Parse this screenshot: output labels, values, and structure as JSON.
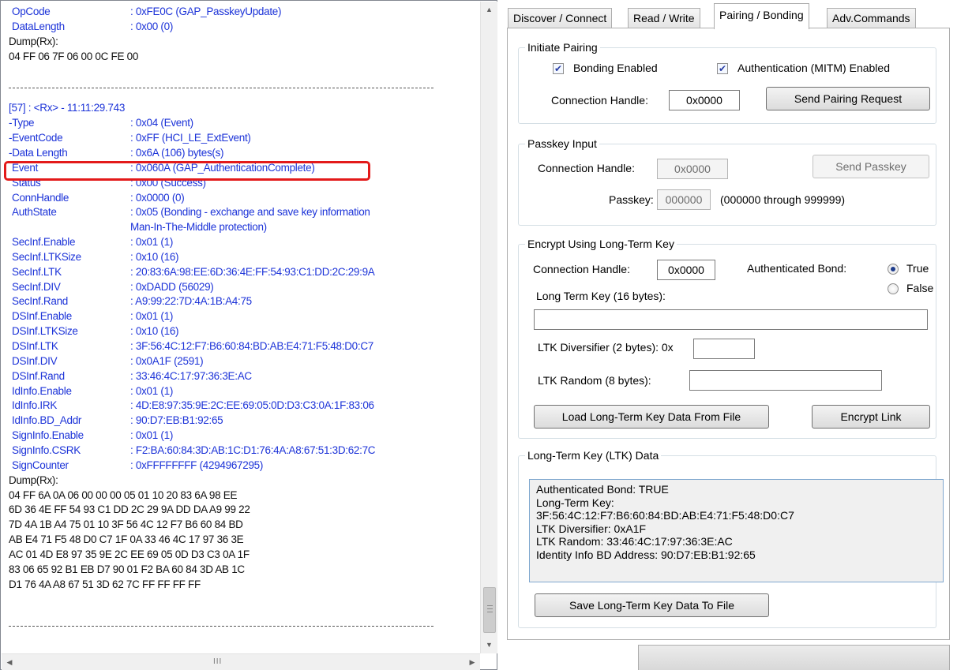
{
  "log": {
    "rows": [
      {
        "k": "OpCode",
        "v": ": 0xFE0C (GAP_PasskeyUpdate)",
        "indent": true
      },
      {
        "k": "DataLength",
        "v": ": 0x00 (0)",
        "indent": true
      },
      {
        "plain": "Dump(Rx):"
      },
      {
        "plain": "04 FF 06 7F 06 00 0C FE 00"
      },
      {
        "sep": true
      },
      {
        "k": "[57] : <Rx> - 11:11:29.743",
        "v": ""
      },
      {
        "k": "-Type",
        "v": ": 0x04 (Event)"
      },
      {
        "k": "-EventCode",
        "v": ": 0xFF (HCI_LE_ExtEvent)"
      },
      {
        "k": "-Data Length",
        "v": ": 0x6A (106) bytes(s)"
      },
      {
        "k": "Event",
        "v": ": 0x060A (GAP_AuthenticationComplete)",
        "indent": true
      },
      {
        "k": "Status",
        "v": ": 0x00 (Success)",
        "indent": true
      },
      {
        "k": "ConnHandle",
        "v": ": 0x0000 (0)",
        "indent": true
      },
      {
        "k": "AuthState",
        "v": ": 0x05 (Bonding - exchange and save key information",
        "indent": true
      },
      {
        "k": "",
        "v": "  Man-In-The-Middle protection)"
      },
      {
        "k": "SecInf.Enable",
        "v": ": 0x01 (1)",
        "indent": true
      },
      {
        "k": "SecInf.LTKSize",
        "v": ": 0x10 (16)",
        "indent": true
      },
      {
        "k": "SecInf.LTK",
        "v": ": 20:83:6A:98:EE:6D:36:4E:FF:54:93:C1:DD:2C:29:9A",
        "indent": true
      },
      {
        "k": "SecInf.DIV",
        "v": ": 0xDADD (56029)",
        "indent": true
      },
      {
        "k": "SecInf.Rand",
        "v": ": A9:99:22:7D:4A:1B:A4:75",
        "indent": true
      },
      {
        "k": "DSInf.Enable",
        "v": ": 0x01 (1)",
        "indent": true
      },
      {
        "k": "DSInf.LTKSize",
        "v": ": 0x10 (16)",
        "indent": true
      },
      {
        "k": "DSInf.LTK",
        "v": ": 3F:56:4C:12:F7:B6:60:84:BD:AB:E4:71:F5:48:D0:C7",
        "indent": true
      },
      {
        "k": "DSInf.DIV",
        "v": ": 0x0A1F (2591)",
        "indent": true
      },
      {
        "k": "DSInf.Rand",
        "v": ": 33:46:4C:17:97:36:3E:AC",
        "indent": true
      },
      {
        "k": "IdInfo.Enable",
        "v": ": 0x01 (1)",
        "indent": true
      },
      {
        "k": "IdInfo.IRK",
        "v": ": 4D:E8:97:35:9E:2C:EE:69:05:0D:D3:C3:0A:1F:83:06",
        "indent": true
      },
      {
        "k": "IdInfo.BD_Addr",
        "v": ": 90:D7:EB:B1:92:65",
        "indent": true
      },
      {
        "k": "SignInfo.Enable",
        "v": ": 0x01 (1)",
        "indent": true
      },
      {
        "k": "SignInfo.CSRK",
        "v": ": F2:BA:60:84:3D:AB:1C:D1:76:4A:A8:67:51:3D:62:7C",
        "indent": true
      },
      {
        "k": "SignCounter",
        "v": ": 0xFFFFFFFF (4294967295)",
        "indent": true
      },
      {
        "plain": "Dump(Rx):"
      },
      {
        "plain": "04 FF 6A 0A 06 00 00 00 05 01 10 20 83 6A 98 EE"
      },
      {
        "plain": "6D 36 4E FF 54 93 C1 DD 2C 29 9A DD DA A9 99 22"
      },
      {
        "plain": "7D 4A 1B A4 75 01 10 3F 56 4C 12 F7 B6 60 84 BD"
      },
      {
        "plain": "AB E4 71 F5 48 D0 C7 1F 0A 33 46 4C 17 97 36 3E"
      },
      {
        "plain": "AC 01 4D E8 97 35 9E 2C EE 69 05 0D D3 C3 0A 1F"
      },
      {
        "plain": "83 06 65 92 B1 EB D7 90 01 F2 BA 60 84 3D AB 1C"
      },
      {
        "plain": "D1 76 4A A8 67 51 3D 62 7C FF FF FF FF"
      }
    ],
    "highlight_color": "#e31a1a",
    "text_color": "#1c33d8",
    "hscroll_grip": "III"
  },
  "tabs": {
    "discover": "Discover / Connect",
    "readwrite": "Read / Write",
    "pairing": "Pairing / Bonding",
    "adv": "Adv.Commands",
    "active": "Pairing / Bonding"
  },
  "initiate": {
    "legend": "Initiate Pairing",
    "bonding_label": "Bonding Enabled",
    "bonding_checked": true,
    "auth_label": "Authentication (MITM) Enabled",
    "auth_checked": true,
    "conn_label": "Connection Handle:",
    "conn_value": "0x0000",
    "send_button": "Send Pairing Request"
  },
  "passkey": {
    "legend": "Passkey Input",
    "conn_label": "Connection Handle:",
    "conn_value": "0x0000",
    "send_button": "Send Passkey",
    "passkey_label": "Passkey:",
    "passkey_value": "000000",
    "range_hint": "(000000 through 999999)"
  },
  "encrypt": {
    "legend": "Encrypt Using Long-Term Key",
    "conn_label": "Connection Handle:",
    "conn_value": "0x0000",
    "auth_bond_label": "Authenticated Bond:",
    "true_label": "True",
    "false_label": "False",
    "selected": "True",
    "ltk_label": "Long Term Key (16 bytes):",
    "ltk_value": "",
    "div_label": "LTK Diversifier (2 bytes): 0x",
    "div_value": "",
    "rand_label": "LTK Random (8 bytes):",
    "rand_value": "",
    "load_button": "Load Long-Term Key Data From File",
    "encrypt_button": "Encrypt Link"
  },
  "ltk_data": {
    "legend": "Long-Term Key (LTK) Data",
    "lines": [
      "Authenticated Bond: TRUE",
      "Long-Term Key:",
      "3F:56:4C:12:F7:B6:60:84:BD:AB:E4:71:F5:48:D0:C7",
      "LTK Diversifier: 0xA1F",
      "LTK Random: 33:46:4C:17:97:36:3E:AC",
      "Identity Info BD Address: 90:D7:EB:B1:92:65"
    ],
    "save_button": "Save Long-Term Key Data To File"
  }
}
